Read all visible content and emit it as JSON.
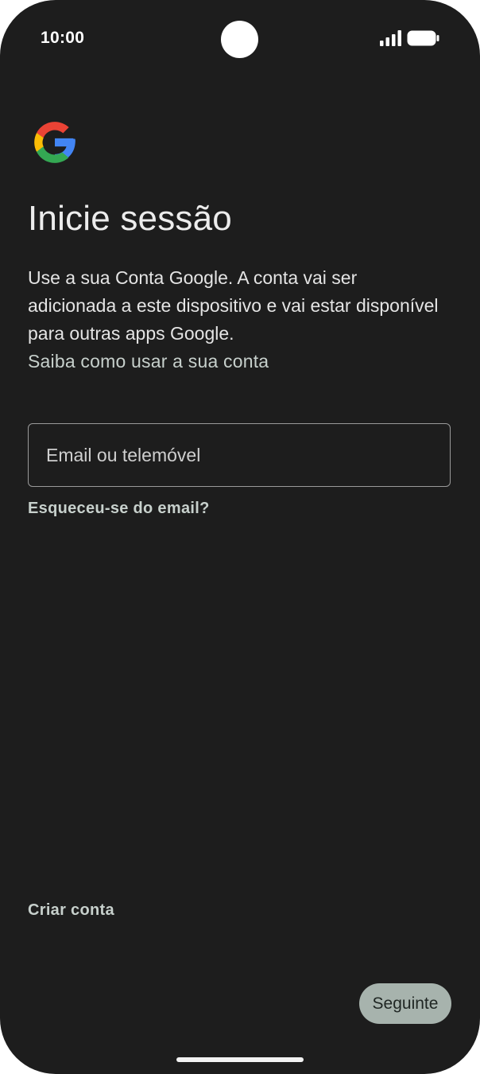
{
  "status_bar": {
    "time": "10:00",
    "icons": [
      "signal-icon",
      "battery-icon"
    ]
  },
  "logo": {
    "icon": "google-logo-icon",
    "colors": [
      "#4285F4",
      "#EA4335",
      "#FBBC05",
      "#34A853"
    ]
  },
  "main": {
    "title": "Inicie sessão",
    "description": "Use a sua Conta Google. A conta vai ser adicionada a este dispositivo e vai estar disponível para outras apps Google.",
    "learn_link": "Saiba como usar a sua conta",
    "email_field": {
      "placeholder": "Email ou telemóvel",
      "value": ""
    },
    "forgot_email_link": "Esqueceu-se do email?"
  },
  "footer": {
    "create_account_link": "Criar conta",
    "next_button": "Seguinte"
  },
  "colors": {
    "background": "#1d1d1d",
    "link": "#c7d0cc",
    "button": "#a7b3ad"
  }
}
